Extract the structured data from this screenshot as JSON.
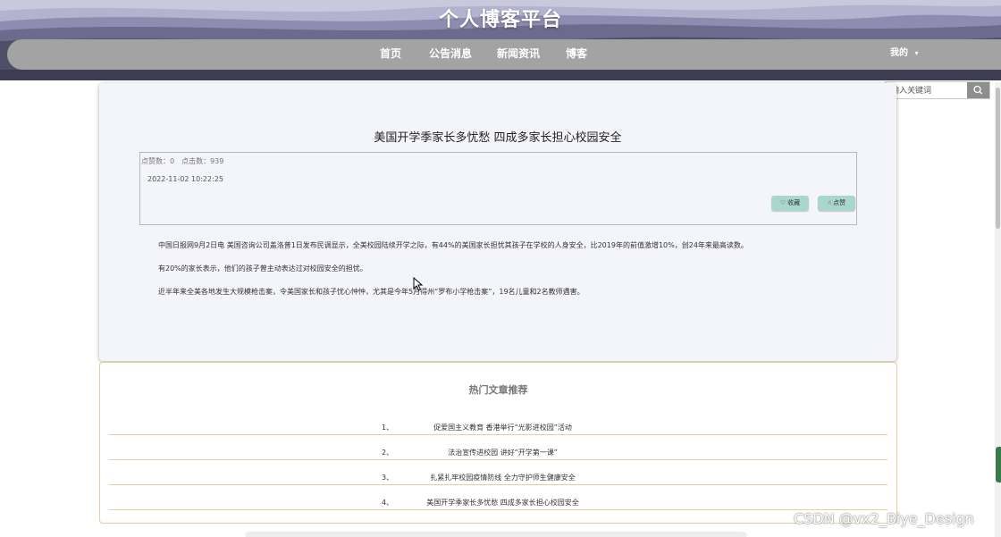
{
  "site": {
    "title": "个人博客平台"
  },
  "nav": {
    "items": [
      "首页",
      "公告消息",
      "新闻资讯",
      "博客"
    ],
    "user_label": "我的",
    "user_caret": "▾"
  },
  "search": {
    "placeholder": "输入关键词",
    "icon": "search-icon"
  },
  "article": {
    "title": "美国开学季家长多忧愁 四成多家长担心校园安全",
    "stats": "点赞数：0　点击数：939",
    "date": "2022-11-02 10:22:25",
    "buttons": {
      "favorite": "收藏",
      "like": "点赞"
    },
    "paragraphs": [
      "中国日报网9月2日电 美国咨询公司盖洛普1日发布民调显示，全美校园陆续开学之际，有44%的美国家长担忧其孩子在学校的人身安全，比2019年的前值激增10%，创24年来最高读数。",
      "有20%的家长表示，他们的孩子曾主动表达过对校园安全的担忧。",
      "近半年来全美各地发生大规模枪击案，令美国家长和孩子忧心忡忡，尤其是今年5月得州“罗布小学枪击案”，19名儿童和2名教师遇害。"
    ]
  },
  "hot": {
    "title": "热门文章推荐",
    "items": [
      {
        "num": "1、",
        "text": "促爱国主义教育 香港举行“光影进校园”活动"
      },
      {
        "num": "2、",
        "text": "法治宣传进校园 讲好“开学第一课”"
      },
      {
        "num": "3、",
        "text": "扎紧扎牢校园疫情防线 全力守护师生健康安全"
      },
      {
        "num": "4、",
        "text": "美国开学季家长多忧愁 四成多家长担心校园安全"
      }
    ]
  },
  "watermark": "CSDN @vx2_Biye_Design",
  "colors": {
    "header": "#4b4e63",
    "nav": "#a3a3a3",
    "card": "#f4f4fb",
    "accent_border": "#e6cf9c",
    "button": "#a9d7d0"
  }
}
